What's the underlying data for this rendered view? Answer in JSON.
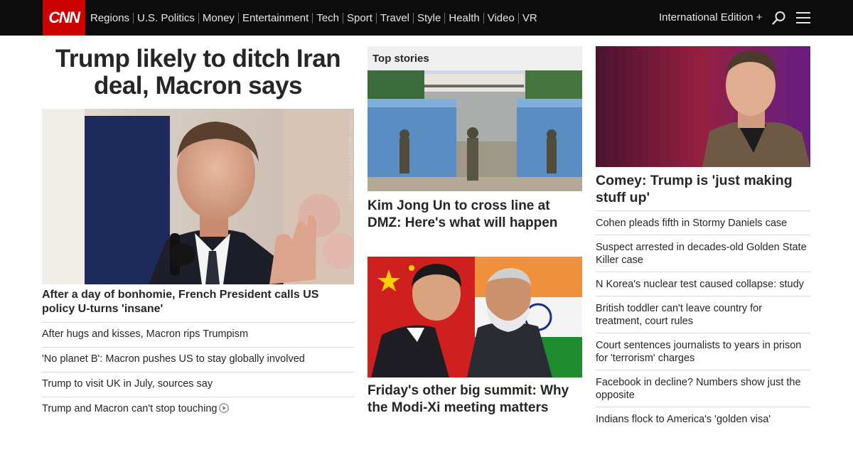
{
  "nav": {
    "logo": "CNN",
    "links": [
      "Regions",
      "U.S. Politics",
      "Money",
      "Entertainment",
      "Tech",
      "Sport",
      "Travel",
      "Style",
      "Health",
      "Video",
      "VR"
    ],
    "edition": "International Edition +"
  },
  "col1": {
    "headline": "Trump likely to ditch Iran deal, Macron says",
    "hero_credit": "LUDOVIC MARIN/AFP/GETTY IMAGES",
    "subheadline": "After a day of bonhomie, French President calls US policy U-turns 'insane'",
    "list": [
      "After hugs and kisses, Macron rips Trumpism",
      "'No planet B': Macron pushes US to stay globally involved",
      "Trump to visit UK in July, sources say",
      "Trump and Macron can't stop touching"
    ]
  },
  "col2": {
    "section_title": "Top stories",
    "story1": "Kim Jong Un to cross line at DMZ: Here's what will happen",
    "story2": "Friday's other big summit: Why the Modi-Xi meeting matters"
  },
  "col3": {
    "headline": "Comey: Trump is 'just making stuff up'",
    "list": [
      "Cohen pleads fifth in Stormy Daniels case",
      "Suspect arrested in decades-old Golden State Killer case",
      "N Korea's nuclear test caused collapse: study",
      "British toddler can't leave country for treatment, court rules",
      "Court sentences journalists to years in prison for 'terrorism' charges",
      "Facebook in decline? Numbers show just the opposite",
      "Indians flock to America's 'golden visa'"
    ]
  },
  "colors": {
    "brand": "#cc0000",
    "nav_bg": "#0c0c0c",
    "text": "#262626",
    "divider": "#d9d9d9"
  },
  "icons": [
    "search-icon",
    "menu-icon",
    "play-icon"
  ]
}
